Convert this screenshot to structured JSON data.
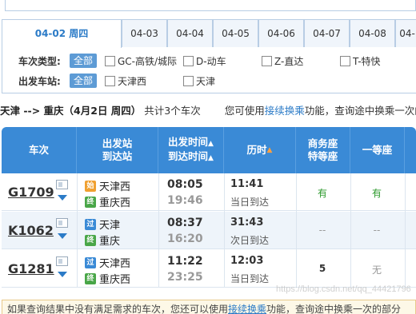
{
  "date_tabs": [
    {
      "label": "04-02 周四",
      "active": true
    },
    {
      "label": "04-03"
    },
    {
      "label": "04-04"
    },
    {
      "label": "04-05"
    },
    {
      "label": "04-06"
    },
    {
      "label": "04-07"
    },
    {
      "label": "04-08"
    },
    {
      "label": "04-"
    }
  ],
  "filters": {
    "type_label": "车次类型:",
    "station_label": "出发车站:",
    "all_label": "全部",
    "types": [
      "GC-高铁/城际",
      "D-动车",
      "Z-直达",
      "T-特快"
    ],
    "stations": [
      "天津西",
      "天津"
    ]
  },
  "summary": {
    "route": "天津 --> 重庆（4月2日 周四）",
    "count": "共计3个车次",
    "tip_prefix": "您可使用",
    "tip_link": "接续换乘",
    "tip_suffix": "功能，查询途中换乘一次的"
  },
  "table": {
    "headers": {
      "train": "车次",
      "stations_1": "出发站",
      "stations_2": "到达站",
      "times_1": "出发时间",
      "times_2": "到达时间",
      "duration": "历时",
      "business_1": "商务座",
      "business_2": "特等座",
      "first": "一等座",
      "sort_arrow": "▲"
    },
    "rows": [
      {
        "train": "G1709",
        "from": "天津西",
        "from_icon": "始",
        "to": "重庆西",
        "to_icon": "终",
        "dep": "08:05",
        "arr": "19:46",
        "duration": "11:41",
        "arrive_day": "当日到达",
        "business": "有",
        "first": "有"
      },
      {
        "train": "K1062",
        "from": "天津",
        "from_icon": "过",
        "to": "重庆",
        "to_icon": "终",
        "dep": "08:37",
        "arr": "16:20",
        "duration": "31:43",
        "arrive_day": "次日到达",
        "business": "--",
        "first": "--"
      },
      {
        "train": "G1281",
        "from": "天津西",
        "from_icon": "过",
        "to": "重庆西",
        "to_icon": "终",
        "dep": "11:22",
        "arr": "23:25",
        "duration": "12:03",
        "arrive_day": "当日到达",
        "business": "5",
        "first": "无"
      }
    ]
  },
  "bottom_note": {
    "prefix": "如果查询结果中没有满足需求的车次，您还可以使用",
    "link": "接续换乘",
    "suffix": "功能，查询途中换乘一次的部分"
  },
  "watermark": "https://blog.csdn.net/qq_44421796",
  "colors": {
    "accent": "#3a8ad6",
    "link": "#2b7bc7",
    "available": "#2d9a2d"
  }
}
